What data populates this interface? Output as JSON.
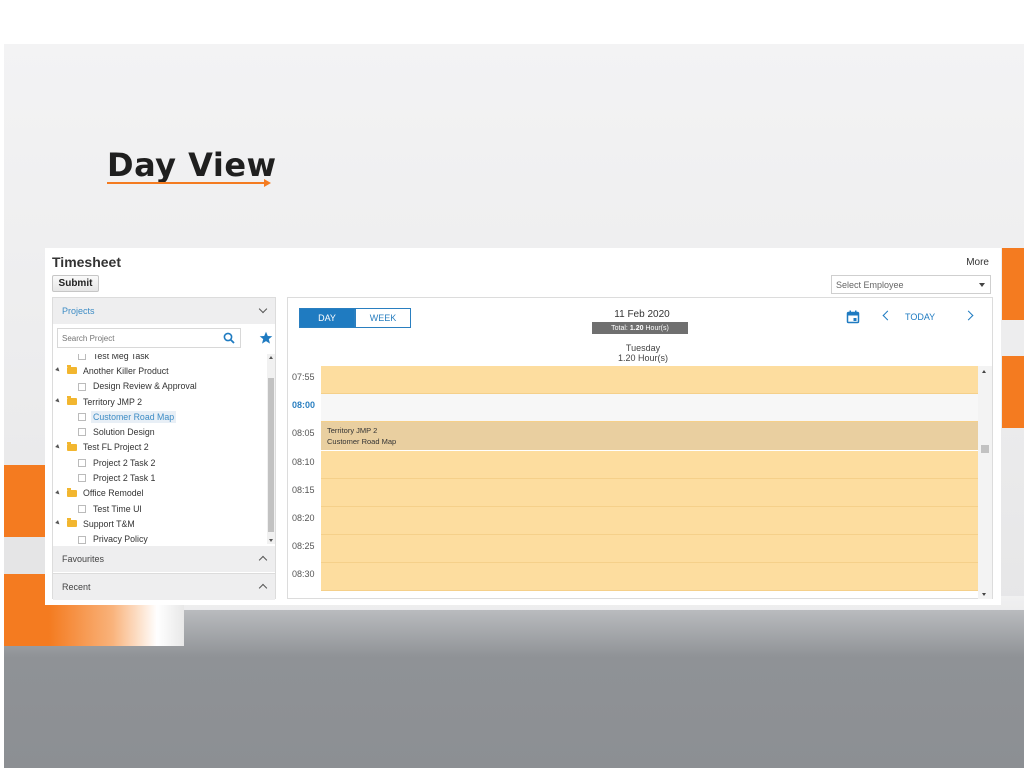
{
  "slide": {
    "title": "Day View"
  },
  "app": {
    "title": "Timesheet",
    "more_label": "More",
    "submit_label": "Submit",
    "employee_placeholder": "Select Employee"
  },
  "left_panel": {
    "projects_header": "Projects",
    "search_placeholder": "Search Project",
    "tree": [
      {
        "type": "task",
        "label": "Test Meg Task"
      },
      {
        "type": "project",
        "label": "Another Killer Product"
      },
      {
        "type": "task",
        "label": "Design Review & Approval"
      },
      {
        "type": "project",
        "label": "Territory JMP 2"
      },
      {
        "type": "task",
        "label": "Customer Road Map",
        "selected": true
      },
      {
        "type": "task",
        "label": "Solution Design"
      },
      {
        "type": "project",
        "label": "Test FL Project 2"
      },
      {
        "type": "task",
        "label": "Project 2 Task 2"
      },
      {
        "type": "task",
        "label": "Project 2 Task 1"
      },
      {
        "type": "project",
        "label": "Office Remodel"
      },
      {
        "type": "task",
        "label": "Test Time UI"
      },
      {
        "type": "project",
        "label": "Support T&M"
      },
      {
        "type": "task",
        "label": "Privacy Policy"
      }
    ],
    "favourites_header": "Favourites",
    "recent_header": "Recent"
  },
  "calendar": {
    "day_label": "DAY",
    "week_label": "WEEK",
    "date": "11 Feb 2020",
    "total_prefix": "Total:",
    "total_value": "1.20",
    "total_suffix": "Hour(s)",
    "day_name": "Tuesday",
    "day_hours": "1.20 Hour(s)",
    "today_label": "TODAY",
    "time_slots": [
      "07:55",
      "08:00",
      "08:05",
      "08:10",
      "08:15",
      "08:20",
      "08:25",
      "08:30"
    ],
    "current_time": "08:00",
    "entry": {
      "project": "Territory JMP 2",
      "task": "Customer Road Map",
      "start": "08:05"
    },
    "colors": {
      "slot": "#fddd9f",
      "entry": "#e9cfa0",
      "accent": "#1f7bc1"
    }
  },
  "colors": {
    "brand_orange": "#f47b20"
  }
}
